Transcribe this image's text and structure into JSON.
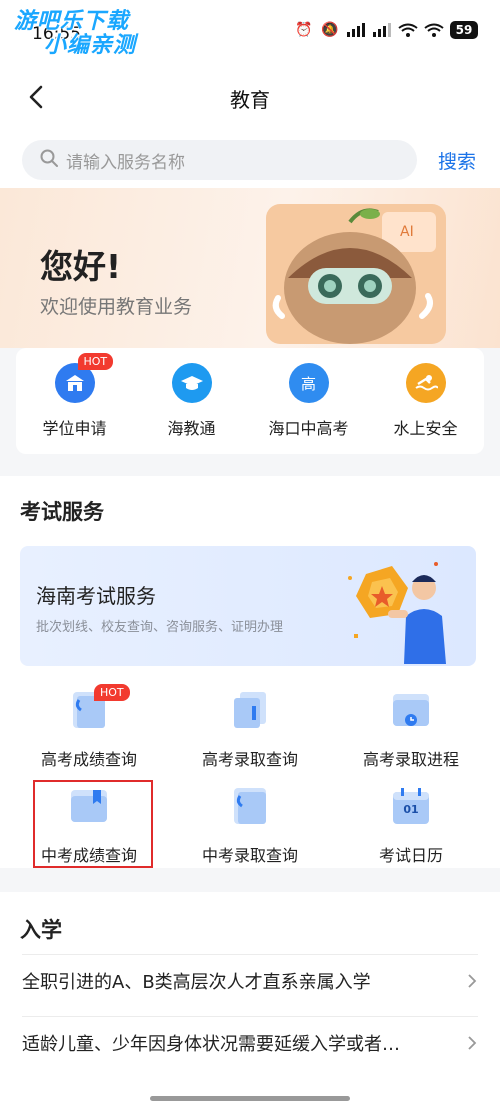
{
  "watermark": {
    "line1": "游吧乐下载",
    "line2": "小编亲测"
  },
  "status": {
    "time": "16:55",
    "battery": "59"
  },
  "header": {
    "title": "教育"
  },
  "search": {
    "placeholder": "请输入服务名称",
    "button": "搜索"
  },
  "banner": {
    "greeting": "您好!",
    "subtitle": "欢迎使用教育业务"
  },
  "quick_services": [
    {
      "label": "学位申请",
      "icon": "school-icon",
      "badge": "HOT",
      "color": "#2f7bf0"
    },
    {
      "label": "海教通",
      "icon": "graduation-cap-icon",
      "color": "#1e9af0"
    },
    {
      "label": "海口中高考",
      "icon": "exam-gao-icon",
      "glyph": "高",
      "color": "#2f8cf0"
    },
    {
      "label": "水上安全",
      "icon": "swimming-icon",
      "color": "#f5a623"
    }
  ],
  "exam_section": {
    "title": "考试服务",
    "banner": {
      "title": "海南考试服务",
      "subtitle": "批次划线、校友查询、咨询服务、证明办理"
    },
    "items": [
      {
        "label": "高考成绩查询",
        "icon": "clipped-document-icon",
        "badge": "HOT"
      },
      {
        "label": "高考录取查询",
        "icon": "document-stack-icon"
      },
      {
        "label": "高考录取进程",
        "icon": "folder-clock-icon"
      },
      {
        "label": "中考成绩查询",
        "icon": "bookmark-folder-icon"
      },
      {
        "label": "中考录取查询",
        "icon": "clipped-document-icon"
      },
      {
        "label": "考试日历",
        "icon": "calendar-icon",
        "glyph": "01"
      }
    ]
  },
  "admission_section": {
    "title": "入学",
    "items": [
      {
        "label": "全职引进的A、B类高层次人才直系亲属入学"
      },
      {
        "label": "适龄儿童、少年因身体状况需要延缓入学或者…"
      }
    ]
  }
}
